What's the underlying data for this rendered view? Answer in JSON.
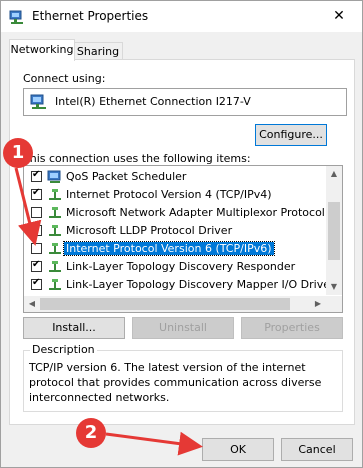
{
  "window": {
    "title": "Ethernet Properties",
    "close_glyph": "✕"
  },
  "tabs": [
    {
      "label": "Networking"
    },
    {
      "label": "Sharing"
    }
  ],
  "connect_using": {
    "label": "Connect using:",
    "adapter": "Intel(R) Ethernet Connection I217-V",
    "configure_label": "Configure..."
  },
  "items_label": "This connection uses the following items:",
  "items": [
    {
      "label": "QoS Packet Scheduler",
      "checked": true,
      "icon": "scheduler-icon"
    },
    {
      "label": "Internet Protocol Version 4 (TCP/IPv4)",
      "checked": true,
      "icon": "protocol-icon"
    },
    {
      "label": "Microsoft Network Adapter Multiplexor Protocol",
      "checked": false,
      "icon": "protocol-icon"
    },
    {
      "label": "Microsoft LLDP Protocol Driver",
      "checked": true,
      "icon": "protocol-icon"
    },
    {
      "label": "Internet Protocol Version 6 (TCP/IPv6)",
      "checked": false,
      "icon": "protocol-icon",
      "selected": true
    },
    {
      "label": "Link-Layer Topology Discovery Responder",
      "checked": true,
      "icon": "protocol-icon"
    },
    {
      "label": "Link-Layer Topology Discovery Mapper I/O Driver",
      "checked": true,
      "icon": "protocol-icon"
    }
  ],
  "actions": {
    "install": "Install...",
    "uninstall": "Uninstall",
    "properties": "Properties"
  },
  "description": {
    "title": "Description",
    "text": "TCP/IP version 6. The latest version of the internet protocol that provides communication across diverse interconnected networks."
  },
  "footer": {
    "ok": "OK",
    "cancel": "Cancel"
  },
  "annotations": {
    "step1": "1",
    "step2": "2",
    "color": "#e53935"
  }
}
